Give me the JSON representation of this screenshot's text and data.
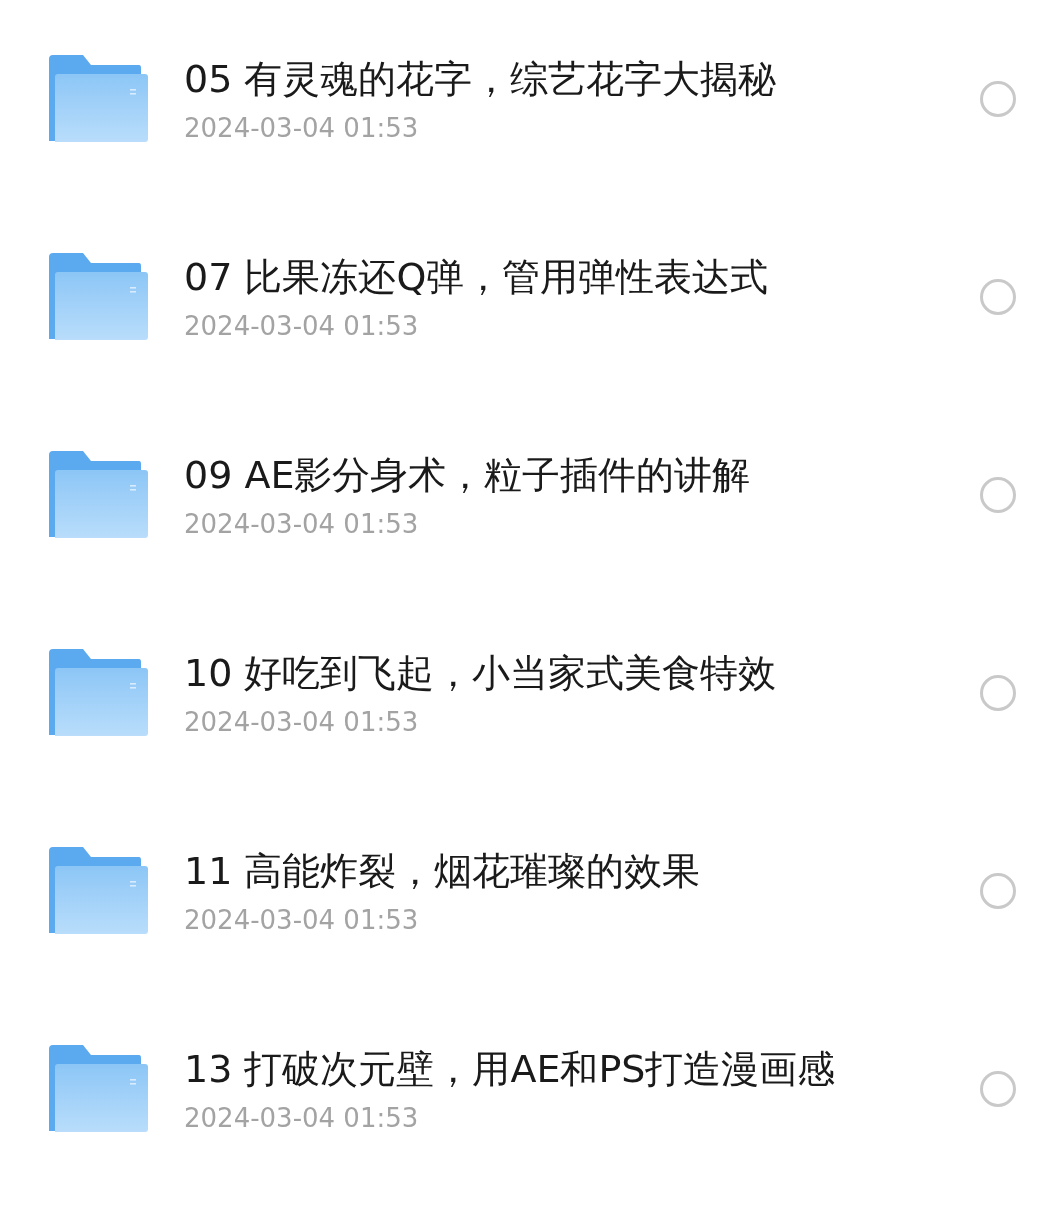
{
  "files": [
    {
      "name": "05 有灵魂的花字，综艺花字大揭秘",
      "date": "2024-03-04 01:53",
      "selected": false
    },
    {
      "name": "07 比果冻还Q弹，管用弹性表达式",
      "date": "2024-03-04 01:53",
      "selected": false
    },
    {
      "name": "09 AE影分身术，粒子插件的讲解",
      "date": "2024-03-04 01:53",
      "selected": false
    },
    {
      "name": "10 好吃到飞起，小当家式美食特效",
      "date": "2024-03-04 01:53",
      "selected": false
    },
    {
      "name": "11 高能炸裂，烟花璀璨的效果",
      "date": "2024-03-04 01:53",
      "selected": false
    },
    {
      "name": "13 打破次元壁，用AE和PS打造漫画感",
      "date": "2024-03-04 01:53",
      "selected": false
    }
  ]
}
